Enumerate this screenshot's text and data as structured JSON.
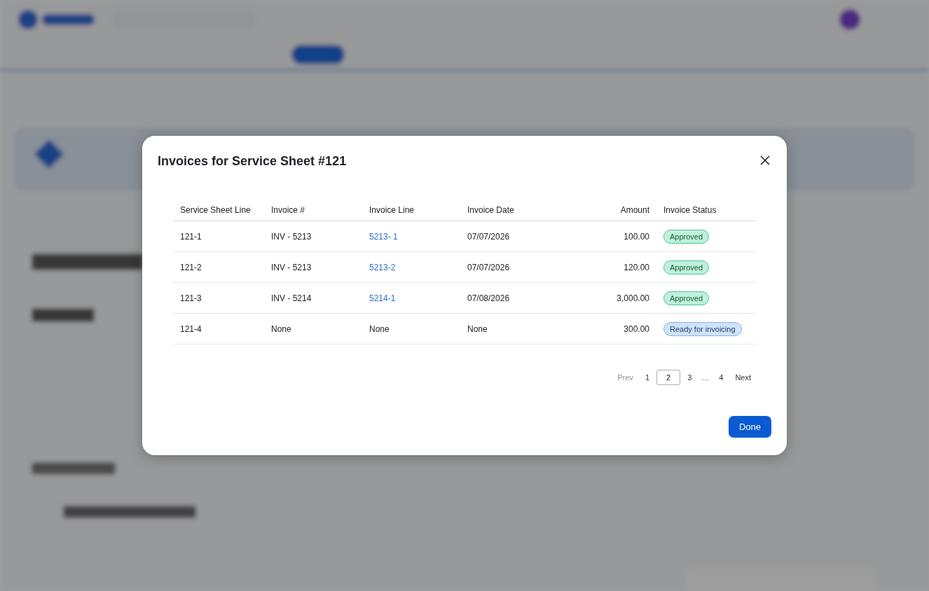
{
  "dialog": {
    "title": "Invoices for Service Sheet #121",
    "table": {
      "columns": [
        "Service Sheet Line",
        "Invoice #",
        "Invoice Line",
        "Invoice Date",
        "Amount",
        "Invoice Status"
      ],
      "rows": [
        {
          "line": "121-1",
          "invoice": "INV - 5213",
          "invoice_line": {
            "text": "5213- 1",
            "kind": "link"
          },
          "date": "07/07/2026",
          "amount": "100.00",
          "status": {
            "label": "Approved",
            "kind": "approved"
          }
        },
        {
          "line": "121-2",
          "invoice": "INV - 5213",
          "invoice_line": {
            "text": "5213-2",
            "kind": "link"
          },
          "date": "07/07/2026",
          "amount": "120.00",
          "status": {
            "label": "Approved",
            "kind": "approved"
          }
        },
        {
          "line": "121-3",
          "invoice": "INV - 5214",
          "invoice_line": {
            "text": "5214-1",
            "kind": "link"
          },
          "date": "07/08/2026",
          "amount": "3,000.00",
          "status": {
            "label": "Approved",
            "kind": "approved"
          }
        },
        {
          "line": "121-4",
          "invoice": "None",
          "invoice_line": {
            "text": "None",
            "kind": "text"
          },
          "date": "None",
          "amount": "300.00",
          "status": {
            "label": "Ready for invoicing",
            "kind": "ready"
          }
        }
      ]
    },
    "pagination": {
      "prev": {
        "label": "Prev",
        "disabled": true
      },
      "pages": [
        {
          "label": "1",
          "kind": "page",
          "selected": false
        },
        {
          "label": "2",
          "kind": "page",
          "selected": true
        },
        {
          "label": "3",
          "kind": "page",
          "selected": false
        },
        {
          "label": "…",
          "kind": "ellipsis"
        },
        {
          "label": "4",
          "kind": "page",
          "selected": false
        }
      ],
      "next": {
        "label": "Next",
        "disabled": false
      }
    },
    "done_button": "Done"
  }
}
